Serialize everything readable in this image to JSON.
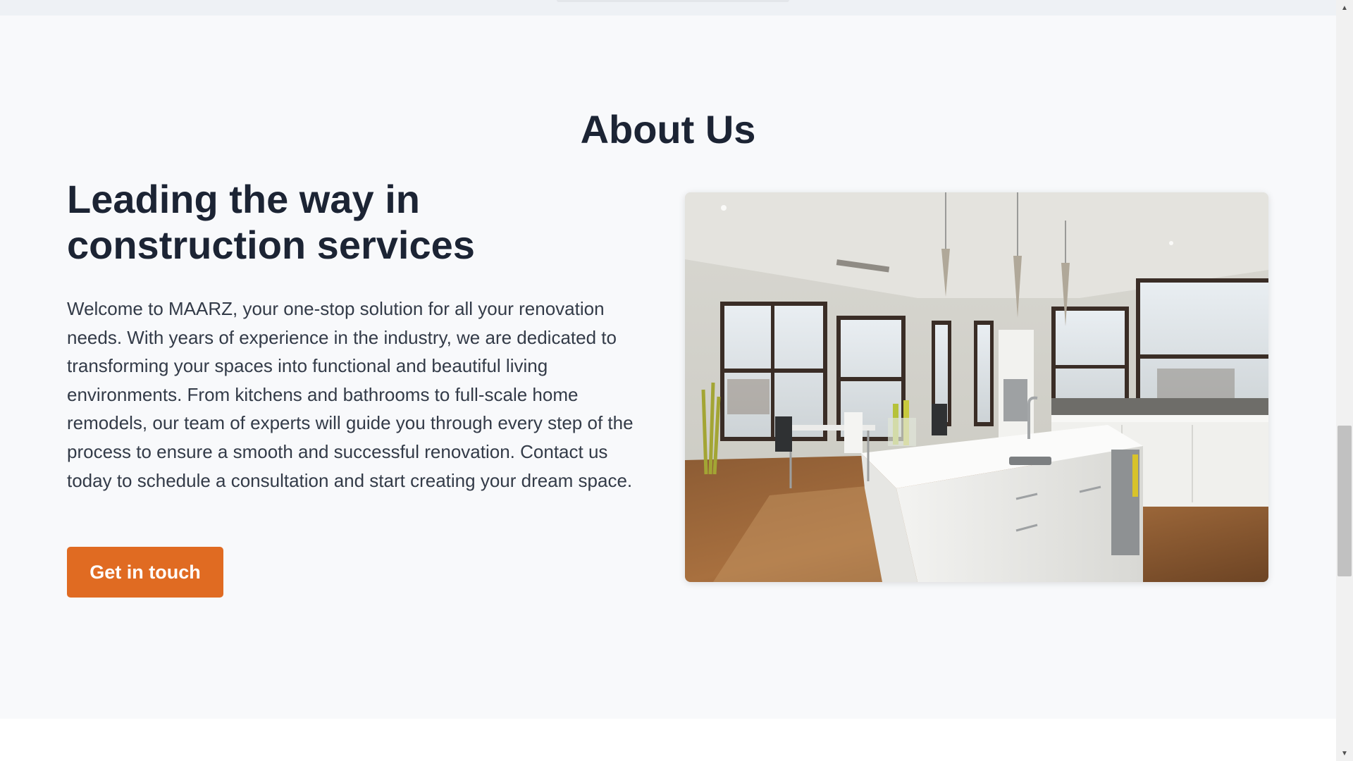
{
  "about": {
    "section_title": "About Us",
    "headline": "Leading the way in construction services",
    "body": "Welcome to MAARZ, your one-stop solution for all your renovation needs. With years of experience in the industry, we are dedicated to transforming your spaces into functional and beautiful living environments. From kitchens and bathrooms to full-scale home remodels, our team of experts will guide you through every step of the process to ensure a smooth and successful renovation. Contact us today to schedule a consultation and start creating your dream space.",
    "cta_label": "Get in touch",
    "image_alt": "Bright modern kitchen with white island and large windows"
  },
  "colors": {
    "accent": "#e06b22",
    "heading": "#1c2434",
    "body_text": "#333b48",
    "section_bg": "#f8f9fb"
  },
  "icons": {
    "scroll_up": "triangle-up-icon",
    "scroll_down": "triangle-down-icon"
  }
}
